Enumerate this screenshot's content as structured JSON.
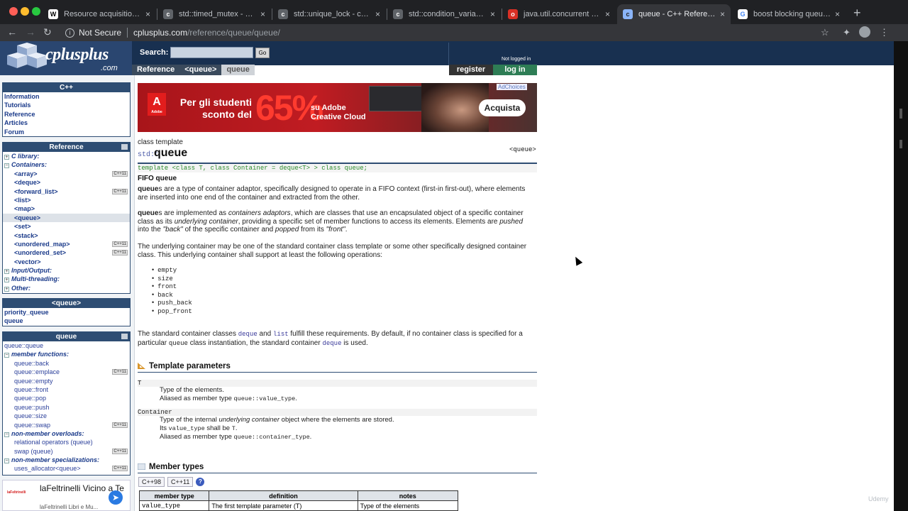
{
  "browser": {
    "tabs": [
      {
        "title": "Resource acquisition is in",
        "fav": "W",
        "favbg": "#ffffff",
        "favfg": "#000000"
      },
      {
        "title": "std::timed_mutex - cppref",
        "fav": "c",
        "favbg": "#5f6368",
        "favfg": "#ffffff"
      },
      {
        "title": "std::unique_lock - cppref",
        "fav": "c",
        "favbg": "#5f6368",
        "favfg": "#ffffff"
      },
      {
        "title": "std::condition_variable - c",
        "fav": "c",
        "favbg": "#5f6368",
        "favfg": "#ffffff"
      },
      {
        "title": "java.util.concurrent (Java",
        "fav": "o",
        "favbg": "#d93025",
        "favfg": "#ffffff"
      },
      {
        "title": "queue - C++ Reference",
        "fav": "c",
        "favbg": "#8ab4f8",
        "favfg": "#202124"
      },
      {
        "title": "boost blocking queue - G",
        "fav": "G",
        "favbg": "#ffffff",
        "favfg": "#4285f4"
      }
    ],
    "active_tab": 5,
    "security_label": "Not Secure",
    "url_host": "cplusplus.com",
    "url_path": "/reference/queue/queue/"
  },
  "site": {
    "logo_text": "cplusplus",
    "logo_suffix": ".com",
    "search_label": "Search:",
    "search_value": "",
    "go_label": "Go",
    "not_logged_in": "Not logged in",
    "register_label": "register",
    "login_label": "log in",
    "breadcrumbs": [
      "Reference",
      "<queue>",
      "queue"
    ]
  },
  "sidebar": {
    "cpp_box": {
      "title": "C++",
      "items": [
        "Information",
        "Tutorials",
        "Reference",
        "Articles",
        "Forum"
      ]
    },
    "ref_box": {
      "title": "Reference",
      "items": [
        {
          "label": "C library:",
          "kind": "group",
          "tog": "+"
        },
        {
          "label": "Containers:",
          "kind": "group",
          "tog": "−"
        },
        {
          "label": "<array>",
          "kind": "sub",
          "badge": "C++11"
        },
        {
          "label": "<deque>",
          "kind": "sub"
        },
        {
          "label": "<forward_list>",
          "kind": "sub",
          "badge": "C++11"
        },
        {
          "label": "<list>",
          "kind": "sub"
        },
        {
          "label": "<map>",
          "kind": "sub"
        },
        {
          "label": "<queue>",
          "kind": "sub",
          "selected": true
        },
        {
          "label": "<set>",
          "kind": "sub"
        },
        {
          "label": "<stack>",
          "kind": "sub"
        },
        {
          "label": "<unordered_map>",
          "kind": "sub",
          "badge": "C++11"
        },
        {
          "label": "<unordered_set>",
          "kind": "sub",
          "badge": "C++11"
        },
        {
          "label": "<vector>",
          "kind": "sub"
        },
        {
          "label": "Input/Output:",
          "kind": "group",
          "tog": "+"
        },
        {
          "label": "Multi-threading:",
          "kind": "group",
          "tog": "+"
        },
        {
          "label": "Other:",
          "kind": "group",
          "tog": "+"
        }
      ]
    },
    "queue_hdr_box": {
      "title": "<queue>",
      "items": [
        "priority_queue",
        "queue"
      ]
    },
    "queue_box": {
      "title": "queue",
      "items": [
        {
          "label": "queue::queue",
          "kind": "plain"
        },
        {
          "label": "member functions:",
          "kind": "group",
          "tog": "−"
        },
        {
          "label": "queue::back",
          "kind": "sub"
        },
        {
          "label": "queue::emplace",
          "kind": "sub",
          "badge": "C++11"
        },
        {
          "label": "queue::empty",
          "kind": "sub"
        },
        {
          "label": "queue::front",
          "kind": "sub"
        },
        {
          "label": "queue::pop",
          "kind": "sub"
        },
        {
          "label": "queue::push",
          "kind": "sub"
        },
        {
          "label": "queue::size",
          "kind": "sub"
        },
        {
          "label": "queue::swap",
          "kind": "sub",
          "badge": "C++11"
        },
        {
          "label": "non-member overloads:",
          "kind": "group",
          "tog": "−"
        },
        {
          "label": "relational operators (queue)",
          "kind": "sub"
        },
        {
          "label": "swap (queue)",
          "kind": "sub",
          "badge": "C++11"
        },
        {
          "label": "non-member specializations:",
          "kind": "group",
          "tog": "−"
        },
        {
          "label": "uses_allocator<queue>",
          "kind": "sub",
          "badge": "C++11"
        }
      ]
    },
    "ad": {
      "logo": "laFeltrinelli",
      "title": "laFeltrinelli Vicino a Te",
      "subtitle": "laFeltrinelli Libri e Mu..."
    }
  },
  "banner": {
    "line1": "Per gli studenti sconto del",
    "percent": "65%",
    "line2": "su Adobe Creative Cloud",
    "cta": "Acquista",
    "adchoices": "AdChoices",
    "brand": "Adobe"
  },
  "doc": {
    "kind": "class template",
    "ns": "std::",
    "name": "queue",
    "header": "<queue>",
    "prototype": "template <class T, class Container = deque<T> > class queue;",
    "subtitle": "FIFO queue",
    "p1_k": "queue",
    "p1": "s are a type of container adaptor, specifically designed to operate in a FIFO context (first-in first-out), where elements are inserted into one end of the container and extracted from the other.",
    "p2_k": "queue",
    "p2a": "s are implemented as ",
    "p2b": "containers adaptors",
    "p2c": ", which are classes that use an encapsulated object of a specific container class as its ",
    "p2d": "underlying container",
    "p2e": ", providing a specific set of member functions to access its elements. Elements are ",
    "p2f": "pushed",
    "p2g": " into the ",
    "p2h": "\"back\"",
    "p2i": " of the specific container and ",
    "p2j": "popped",
    "p2k": " from its ",
    "p2l": "\"front\"",
    "p2m": ".",
    "p3": "The underlying container may be one of the standard container class template or some other specifically designed container class. This underlying container shall support at least the following operations:",
    "ops": [
      "empty",
      "size",
      "front",
      "back",
      "push_back",
      "pop_front"
    ],
    "p4a": "The standard container classes ",
    "p4b": "deque",
    "p4c": " and ",
    "p4d": "list",
    "p4e": " fulfill these requirements. By default, if no container class is specified for a particular ",
    "p4f": "queue",
    "p4g": " class instantiation, the standard container ",
    "p4h": "deque",
    "p4i": " is used.",
    "tp_title": "Template parameters",
    "tp_T": "T",
    "tp_T_1": "Type of the elements.",
    "tp_T_2a": "Aliased as member type ",
    "tp_T_2b": "queue::value_type",
    "tp_T_2c": ".",
    "tp_C": "Container",
    "tp_C_1a": "Type of the internal ",
    "tp_C_1b": "underlying container",
    "tp_C_1c": " object where the elements are stored.",
    "tp_C_2a": "Its ",
    "tp_C_2b": "value_type",
    "tp_C_2c": " shall be ",
    "tp_C_2d": "T",
    "tp_C_2e": ".",
    "tp_C_3a": "Aliased as member type ",
    "tp_C_3b": "queue::container_type",
    "tp_C_3c": ".",
    "mt_title": "Member types",
    "versions": [
      "C++98",
      "C++11"
    ],
    "help": "?",
    "mt_headers": [
      "member type",
      "definition",
      "notes"
    ],
    "mt_row": [
      "value_type",
      "The first template parameter (T)",
      "Type of the elements"
    ]
  },
  "watermark": "Udemy"
}
